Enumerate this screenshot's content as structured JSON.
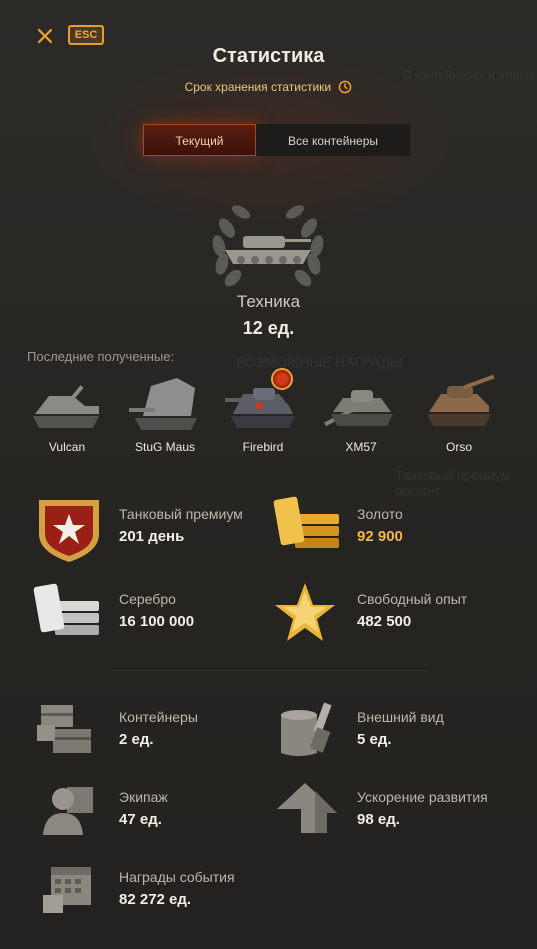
{
  "header": {
    "title": "Статистика",
    "retention_text": "Срок хранения статистики",
    "esc_label": "ESC"
  },
  "tabs": [
    {
      "label": "Текущий",
      "active": true
    },
    {
      "label": "Все контейнеры",
      "active": false
    }
  ],
  "vehicles": {
    "label": "Техника",
    "value": "12 ед.",
    "recent_label": "Последние полученные:",
    "recent": [
      {
        "name": "Vulcan"
      },
      {
        "name": "StuG Maus"
      },
      {
        "name": "Firebird"
      },
      {
        "name": "XM57"
      },
      {
        "name": "Orso"
      }
    ]
  },
  "stats": {
    "premium": {
      "label": "Танковый премиум",
      "value": "201 день"
    },
    "gold": {
      "label": "Золото",
      "value": "92 900"
    },
    "silver": {
      "label": "Серебро",
      "value": "16 100 000"
    },
    "free_xp": {
      "label": "Свободный опыт",
      "value": "482 500"
    },
    "containers": {
      "label": "Контейнеры",
      "value": "2 ед."
    },
    "customization": {
      "label": "Внешний вид",
      "value": "5 ед."
    },
    "crew": {
      "label": "Экипаж",
      "value": "47 ед."
    },
    "boosters": {
      "label": "Ускорение развития",
      "value": "98 ед."
    },
    "event_rewards": {
      "label": "Награды события",
      "value": "82 272 ед."
    }
  },
  "background_ghost": {
    "container_info": "О контейнерах и этапах",
    "possible_rewards": "ВОЗМОЖНЫЕ НАГРАДЫ",
    "premium_account": "Танковый премиум аккаунт"
  },
  "colors": {
    "accent_orange": "#f09a2a",
    "gold_value": "#f3b64a",
    "active_tab": "#5a1d10"
  }
}
